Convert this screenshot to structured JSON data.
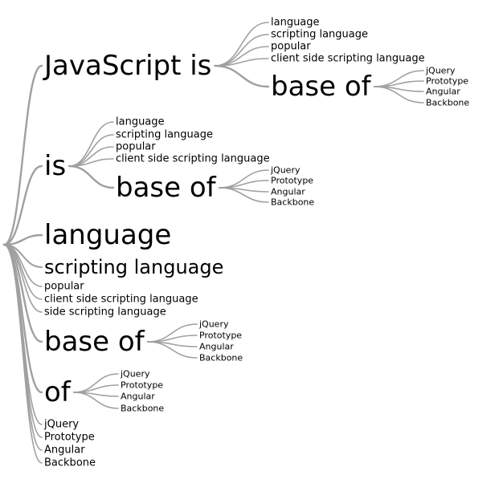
{
  "colors": {
    "edge": "#a0a0a0",
    "text": "#000000",
    "background": "#ffffff"
  },
  "tree": {
    "label": "",
    "children": [
      {
        "label": "JavaScript is",
        "children": [
          {
            "label": "language"
          },
          {
            "label": "scripting language"
          },
          {
            "label": "popular"
          },
          {
            "label": "client side scripting language"
          },
          {
            "label": "base of",
            "children": [
              {
                "label": "jQuery"
              },
              {
                "label": "Prototype"
              },
              {
                "label": "Angular"
              },
              {
                "label": "Backbone"
              }
            ]
          }
        ]
      },
      {
        "label": "is",
        "children": [
          {
            "label": "language"
          },
          {
            "label": "scripting language"
          },
          {
            "label": "popular"
          },
          {
            "label": "client side scripting language"
          },
          {
            "label": "base of",
            "children": [
              {
                "label": "jQuery"
              },
              {
                "label": "Prototype"
              },
              {
                "label": "Angular"
              },
              {
                "label": "Backbone"
              }
            ]
          }
        ]
      },
      {
        "label": "language"
      },
      {
        "label": "scripting language"
      },
      {
        "label": "popular"
      },
      {
        "label": "client side scripting language"
      },
      {
        "label": "side scripting language"
      },
      {
        "label": "base of",
        "children": [
          {
            "label": "jQuery"
          },
          {
            "label": "Prototype"
          },
          {
            "label": "Angular"
          },
          {
            "label": "Backbone"
          }
        ]
      },
      {
        "label": "of",
        "children": [
          {
            "label": "jQuery"
          },
          {
            "label": "Prototype"
          },
          {
            "label": "Angular"
          },
          {
            "label": "Backbone"
          }
        ]
      },
      {
        "label": "jQuery"
      },
      {
        "label": "Prototype"
      },
      {
        "label": "Angular"
      },
      {
        "label": "Backbone"
      }
    ]
  }
}
